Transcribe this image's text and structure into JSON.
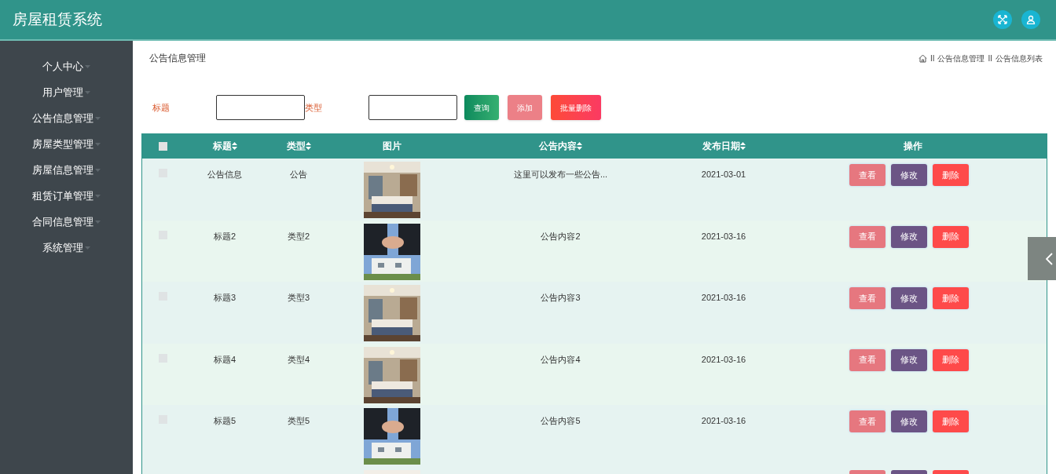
{
  "header": {
    "title": "房屋租赁系统"
  },
  "sidebar": {
    "items": [
      {
        "label": "个人中心"
      },
      {
        "label": "用户管理"
      },
      {
        "label": "公告信息管理"
      },
      {
        "label": "房屋类型管理"
      },
      {
        "label": "房屋信息管理"
      },
      {
        "label": "租赁订单管理"
      },
      {
        "label": "合同信息管理"
      },
      {
        "label": "系统管理"
      }
    ]
  },
  "page_title": "公告信息管理",
  "breadcrumb": [
    {
      "separator": "II",
      "label": "公告信息管理"
    },
    {
      "separator": "II",
      "label": "公告信息列表"
    }
  ],
  "search": {
    "fields": [
      {
        "label": "标题"
      },
      {
        "label": "类型"
      }
    ],
    "buttons": [
      {
        "kind": "query",
        "label": "查询"
      },
      {
        "kind": "add",
        "label": "添加"
      },
      {
        "kind": "batch_delete",
        "label": "批量删除"
      }
    ]
  },
  "table": {
    "columns": [
      {
        "kind": "checkbox",
        "checked": false
      },
      {
        "kind": "sortable",
        "label": "标题"
      },
      {
        "kind": "sortable",
        "label": "类型"
      },
      {
        "kind": "plain",
        "label": "图片"
      },
      {
        "kind": "sortable",
        "label": "公告内容"
      },
      {
        "kind": "sortable",
        "label": "发布日期"
      },
      {
        "kind": "plain",
        "label": "操作"
      }
    ],
    "rows": [
      {
        "checked": false,
        "title": "公告信息",
        "type": "公告",
        "content": "这里可以发布一些公告...",
        "date": "2021-03-01",
        "actions": [
          "查看",
          "修改",
          "删除"
        ]
      },
      {
        "checked": false,
        "title": "标题2",
        "type": "类型2",
        "content": "公告内容2",
        "date": "2021-03-16",
        "actions": [
          "查看",
          "修改",
          "删除"
        ]
      },
      {
        "checked": false,
        "title": "标题3",
        "type": "类型3",
        "content": "公告内容3",
        "date": "2021-03-16",
        "actions": [
          "查看",
          "修改",
          "删除"
        ]
      },
      {
        "checked": false,
        "title": "标题4",
        "type": "类型4",
        "content": "公告内容4",
        "date": "2021-03-16",
        "actions": [
          "查看",
          "修改",
          "删除"
        ]
      },
      {
        "checked": false,
        "title": "标题5",
        "type": "类型5",
        "content": "公告内容5",
        "date": "2021-03-16",
        "actions": [
          "查看",
          "修改",
          "删除"
        ]
      }
    ]
  }
}
